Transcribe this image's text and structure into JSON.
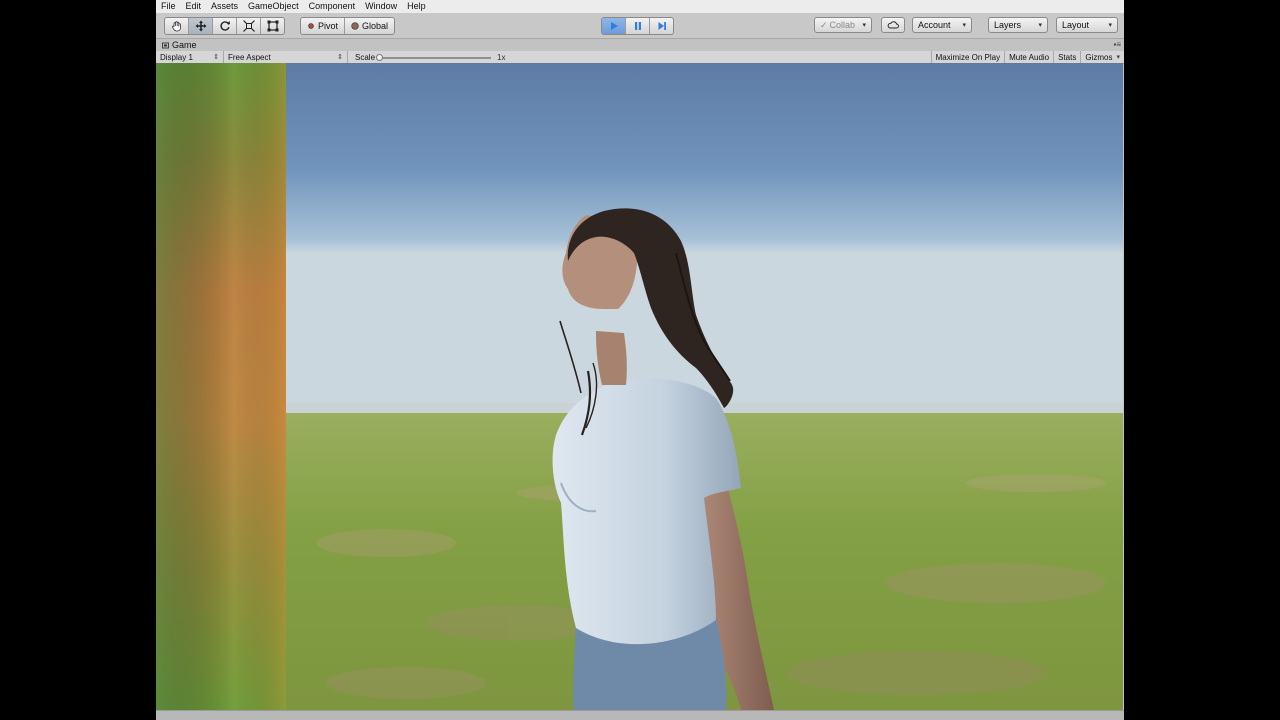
{
  "menu": [
    "File",
    "Edit",
    "Assets",
    "GameObject",
    "Component",
    "Window",
    "Help"
  ],
  "toolbar": {
    "tools": [
      {
        "name": "hand-tool",
        "icon": "hand-icon"
      },
      {
        "name": "move-tool",
        "icon": "move-icon",
        "active": true
      },
      {
        "name": "rotate-tool",
        "icon": "rotate-icon"
      },
      {
        "name": "scale-tool",
        "icon": "scale-icon"
      },
      {
        "name": "rect-tool",
        "icon": "rect-icon"
      }
    ],
    "pivot_label": "Pivot",
    "global_label": "Global",
    "play": {
      "play_icon": "play-icon",
      "pause_icon": "pause-icon",
      "step_icon": "step-icon",
      "playing": true
    },
    "collab_label": "Collab",
    "account_label": "Account",
    "layers_label": "Layers",
    "layout_label": "Layout"
  },
  "tab": {
    "title": "Game"
  },
  "gamebar": {
    "display": "Display 1",
    "aspect": "Free Aspect",
    "scale_label": "Scale",
    "scale_value": "1x",
    "scale_fraction": 0.0,
    "maximize_on_play": "Maximize On Play",
    "mute_audio": "Mute Audio",
    "stats": "Stats",
    "gizmos": "Gizmos"
  },
  "colors": {
    "play_active": "#4a8fe0",
    "sky_top": "#5f7da6",
    "ground": "#84a046",
    "shirt": "#c9d6e2",
    "jeans": "#6f8aa8"
  }
}
